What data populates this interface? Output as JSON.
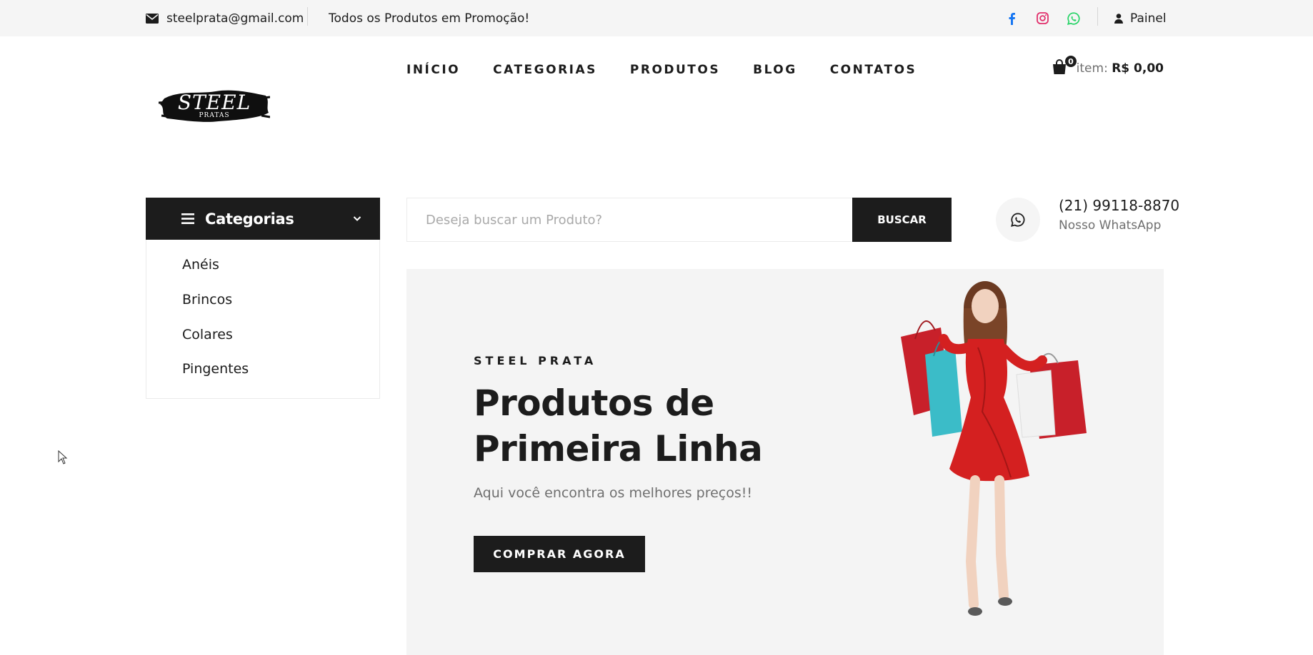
{
  "topbar": {
    "email": "steelprata@gmail.com",
    "promo": "Todos os Produtos em Promoção!",
    "panel_label": "Painel",
    "colors": {
      "facebook": "#1877f2",
      "instagram": "#e1306c",
      "whatsapp": "#25d366"
    }
  },
  "header": {
    "logo_text": "STEEL",
    "logo_subtext": "PRATAS",
    "nav": [
      "INÍCIO",
      "CATEGORIAS",
      "PRODUTOS",
      "BLOG",
      "CONTATOS"
    ],
    "cart_count": "0",
    "cart_label": "item:",
    "cart_total": "R$ 0,00"
  },
  "categories": {
    "title": "Categorias",
    "items": [
      "Anéis",
      "Brincos",
      "Colares",
      "Pingentes"
    ]
  },
  "search": {
    "placeholder": "Deseja buscar um Produto?",
    "button_label": "BUSCAR"
  },
  "whatsapp": {
    "phone": "(21) 99118-8870",
    "label": "Nosso WhatsApp"
  },
  "hero": {
    "kicker": "STEEL PRATA",
    "title_line1": "Produtos de",
    "title_line2": "Primeira Linha",
    "subtitle": "Aqui você encontra os melhores preços!!",
    "button_label": "COMPRAR AGORA"
  },
  "theme": {
    "dark": "#1c1c1c",
    "light_bg": "#f5f5f5",
    "muted_text": "#6f6f6f",
    "dress_red": "#d42020"
  }
}
